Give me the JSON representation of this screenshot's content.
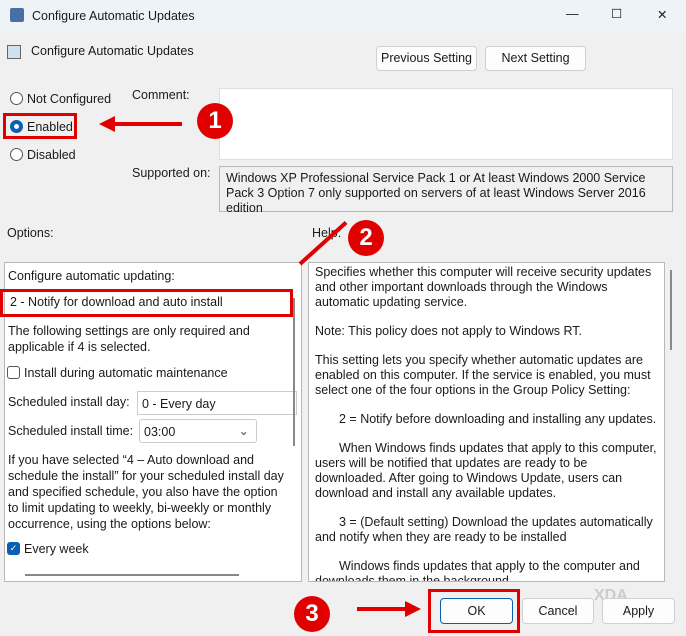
{
  "window": {
    "title": "Configure Automatic Updates",
    "minimize": "—",
    "maximize": "☐",
    "close": "✕"
  },
  "header": {
    "policy_name": "Configure Automatic Updates",
    "prev": "Previous Setting",
    "next": "Next Setting"
  },
  "state": {
    "options": [
      "Not Configured",
      "Enabled",
      "Disabled"
    ],
    "selected": "Enabled"
  },
  "comment_label": "Comment:",
  "supported_label": "Supported on:",
  "supported_text": "Windows XP Professional Service Pack 1 or At least Windows 2000 Service Pack 3 Option 7 only supported on servers of at least Windows Server 2016 edition",
  "options_label": "Options:",
  "help_label": "Help:",
  "options": {
    "configure_label": "Configure automatic updating:",
    "configure_value": "2 - Notify for download and auto install",
    "note": "The following settings are only required and applicable if 4 is selected.",
    "maintenance_label": "Install during automatic maintenance",
    "maintenance_checked": false,
    "day_label": "Scheduled install day:",
    "day_value": "0 - Every day",
    "time_label": "Scheduled install time:",
    "time_value": "03:00",
    "info": "If you have selected “4 – Auto download and schedule the install” for your scheduled install day and specified schedule, you also have the option to limit updating to weekly, bi-weekly or monthly occurrence, using the options below:",
    "every_week_label": "Every week",
    "every_week_checked": true
  },
  "help": [
    "Specifies whether this computer will receive security updates and other important downloads through the Windows automatic updating service.",
    "Note: This policy does not apply to Windows RT.",
    "This setting lets you specify whether automatic updates are enabled on this computer. If the service is enabled, you must select one of the four options in the Group Policy Setting:",
    "2 = Notify before downloading and installing any updates.",
    "When Windows finds updates that apply to this computer, users will be notified that updates are ready to be downloaded. After going to Windows Update, users can download and install any available updates.",
    "3 = (Default setting) Download the updates automatically and notify when they are ready to be installed",
    "Windows finds updates that apply to the computer and downloads them in the background"
  ],
  "footer": {
    "ok": "OK",
    "cancel": "Cancel",
    "apply": "Apply"
  },
  "annotations": {
    "step1": "1",
    "step2": "2",
    "step3": "3",
    "color": "#e00000"
  },
  "watermark": "XDA"
}
